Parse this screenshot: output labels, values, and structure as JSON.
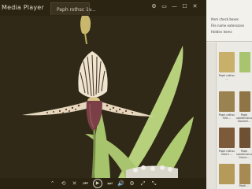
{
  "player": {
    "app_title": "Media Player",
    "tab_label": "Paph rothsc 1v...",
    "window_buttons": [
      "⚙",
      "▭",
      "—",
      "☐",
      "✕"
    ]
  },
  "controls": [
    "⌃",
    "⟲",
    "✕",
    "⏮",
    "▶",
    "⏭",
    "🔊",
    "⚙",
    "⤢",
    "⤡"
  ],
  "explorer": {
    "ribbon_items": [
      "Item check boxes",
      "File name extensions",
      "Hidden items"
    ],
    "thumbnails": [
      {
        "caption": "Paph rothsc ..."
      },
      {
        "caption": "Paph rothsc hild ..."
      },
      {
        "caption": "Paph rothsc Sherri ..."
      },
      {
        "caption": "Paph sanderianum Sanderi..."
      },
      {
        "caption": "Paph sanderianum Grace..."
      },
      {
        "caption": "Paph ..."
      }
    ]
  },
  "colors": {
    "background": "#312917",
    "leaf": "#b8d27a",
    "petal": "#e8d9c0",
    "pouch": "#7a3f47"
  }
}
